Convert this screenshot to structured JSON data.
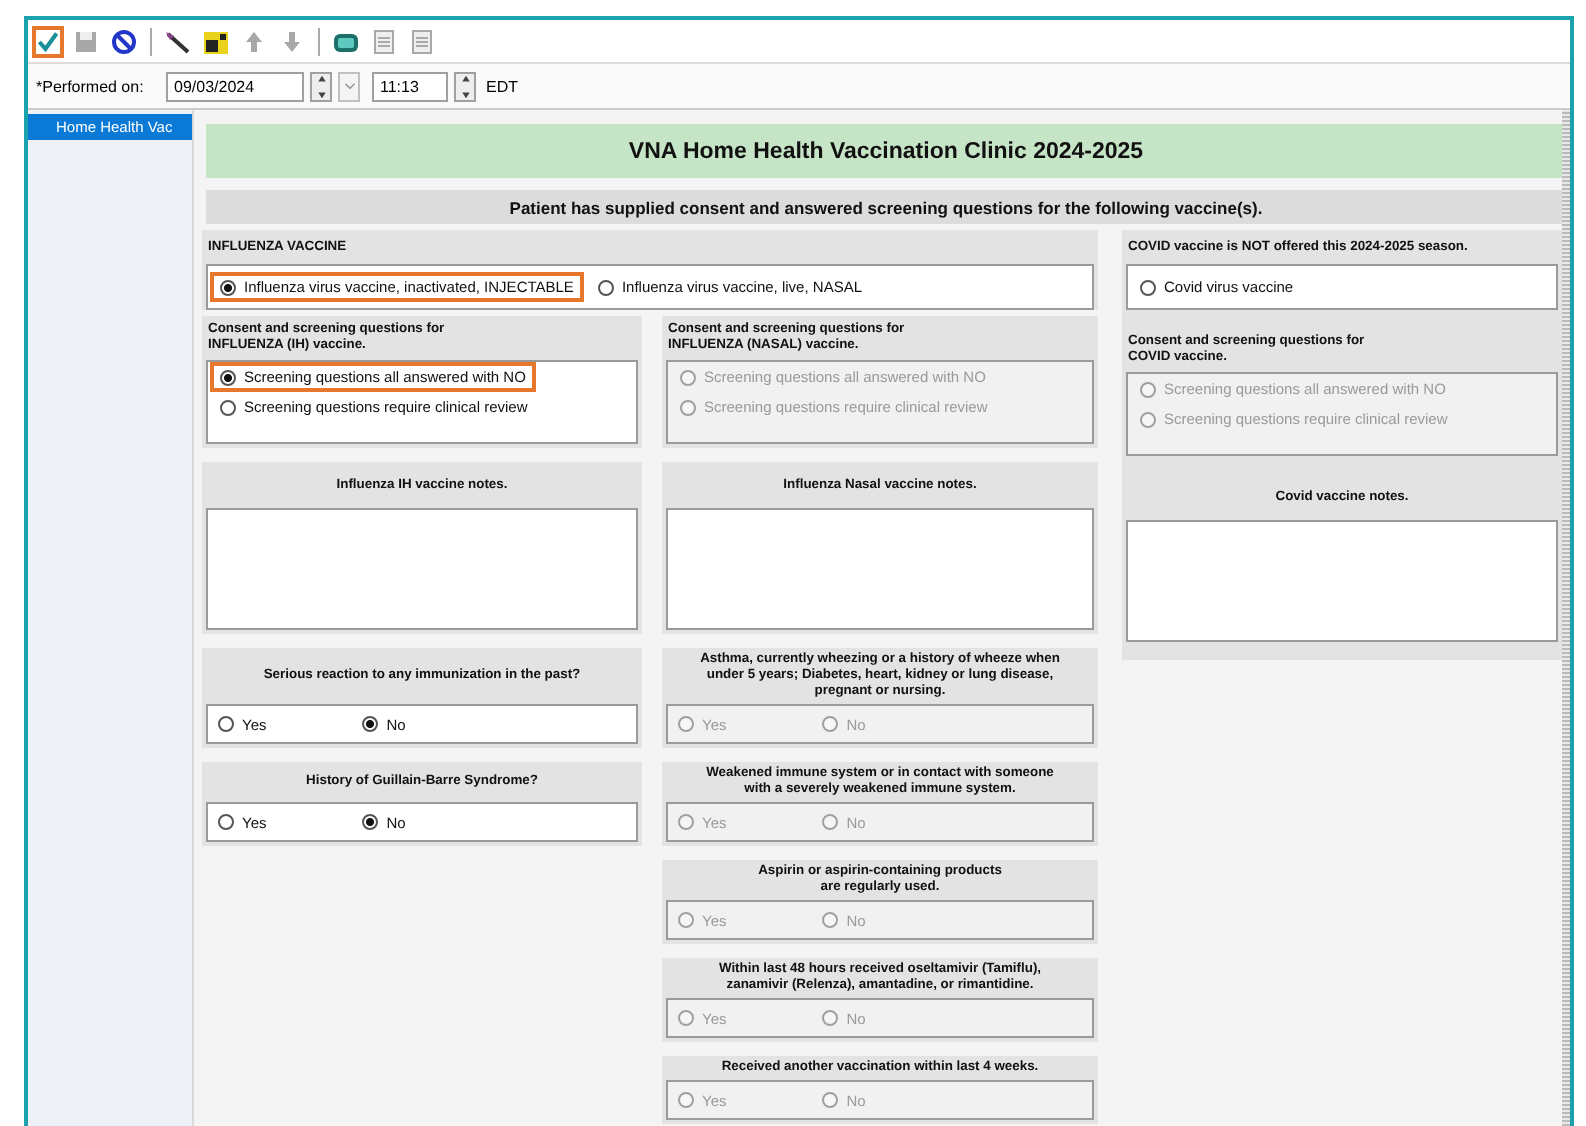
{
  "toolbar": {
    "items": [
      {
        "highlighted": true,
        "disabled": false
      },
      {
        "highlighted": false,
        "disabled": true
      },
      {
        "highlighted": false,
        "disabled": false
      },
      {
        "highlighted": false,
        "disabled": false
      },
      {
        "highlighted": false,
        "disabled": false
      },
      {
        "highlighted": false,
        "disabled": true
      },
      {
        "highlighted": false,
        "disabled": true
      },
      {
        "highlighted": false,
        "disabled": false
      },
      {
        "highlighted": false,
        "disabled": true
      },
      {
        "highlighted": false,
        "disabled": true
      }
    ]
  },
  "performed_on": {
    "label": "*Performed on:",
    "date": "09/03/2024",
    "time": "11:13",
    "zone": "EDT"
  },
  "sidebar": {
    "items": [
      {
        "label": "Home Health Vac",
        "selected": true
      }
    ]
  },
  "form": {
    "title": "VNA Home Health Vaccination Clinic 2024-2025",
    "subtitle": "Patient has supplied consent and answered screening questions for the following vaccine(s).",
    "influenza": {
      "heading": "INFLUENZA VACCINE",
      "options": [
        {
          "label": "Influenza virus vaccine, inactivated, INJECTABLE",
          "selected": true,
          "highlighted": true,
          "disabled": false
        },
        {
          "label": "Influenza virus vaccine, live, NASAL",
          "selected": false,
          "highlighted": false,
          "disabled": false
        }
      ]
    },
    "covid": {
      "heading": "COVID vaccine is NOT offered this 2024-2025 season.",
      "options": [
        {
          "label": "Covid virus vaccine",
          "selected": false,
          "highlighted": false,
          "disabled": false
        }
      ]
    },
    "screening": [
      {
        "heading": "Consent and screening questions for\nINFLUENZA (IH) vaccine.",
        "options": [
          {
            "label": "Screening questions all answered with NO",
            "selected": true,
            "highlighted": true,
            "disabled": false
          },
          {
            "label": "Screening questions require clinical review",
            "selected": false,
            "highlighted": false,
            "disabled": false
          }
        ]
      },
      {
        "heading": "Consent and screening questions for\nINFLUENZA (NASAL) vaccine.",
        "options": [
          {
            "label": "Screening questions all answered with NO",
            "selected": false,
            "highlighted": false,
            "disabled": true
          },
          {
            "label": "Screening questions require clinical review",
            "selected": false,
            "highlighted": false,
            "disabled": true
          }
        ]
      },
      {
        "heading": "Consent and screening questions for\nCOVID vaccine.",
        "options": [
          {
            "label": "Screening questions all answered with NO",
            "selected": false,
            "highlighted": false,
            "disabled": true
          },
          {
            "label": "Screening questions require clinical review",
            "selected": false,
            "highlighted": false,
            "disabled": true
          }
        ]
      }
    ],
    "notes": [
      {
        "label": "Influenza IH vaccine notes."
      },
      {
        "label": "Influenza Nasal vaccine notes."
      },
      {
        "label": "Covid vaccine notes."
      }
    ],
    "questions": {
      "column_1": [
        {
          "text": "Serious reaction to any immunization in the past?",
          "options": [
            {
              "label": "Yes",
              "selected": false,
              "disabled": false
            },
            {
              "label": "No",
              "selected": true,
              "disabled": false
            }
          ]
        },
        {
          "text": "History of Guillain-Barre Syndrome?",
          "options": [
            {
              "label": "Yes",
              "selected": false,
              "disabled": false
            },
            {
              "label": "No",
              "selected": true,
              "disabled": false
            }
          ]
        }
      ],
      "column_2": [
        {
          "text": "Asthma, currently wheezing or a history of wheeze when\nunder 5 years; Diabetes, heart, kidney or lung disease,\npregnant or nursing.",
          "options": [
            {
              "label": "Yes",
              "selected": false,
              "disabled": true
            },
            {
              "label": "No",
              "selected": false,
              "disabled": true
            }
          ]
        },
        {
          "text": "Weakened immune system or in contact with someone\nwith a severely weakened immune system.",
          "options": [
            {
              "label": "Yes",
              "selected": false,
              "disabled": true
            },
            {
              "label": "No",
              "selected": false,
              "disabled": true
            }
          ]
        },
        {
          "text": "Aspirin or aspirin-containing products\nare regularly used.",
          "options": [
            {
              "label": "Yes",
              "selected": false,
              "disabled": true
            },
            {
              "label": "No",
              "selected": false,
              "disabled": true
            }
          ]
        },
        {
          "text": "Within last 48 hours received oseltamivir (Tamiflu),\nzanamivir (Relenza), amantadine, or rimantidine.",
          "options": [
            {
              "label": "Yes",
              "selected": false,
              "disabled": true
            },
            {
              "label": "No",
              "selected": false,
              "disabled": true
            }
          ]
        },
        {
          "text": "Received another vaccination within last 4 weeks.",
          "options": [
            {
              "label": "Yes",
              "selected": false,
              "disabled": true
            },
            {
              "label": "No",
              "selected": false,
              "disabled": true
            }
          ]
        }
      ]
    }
  }
}
